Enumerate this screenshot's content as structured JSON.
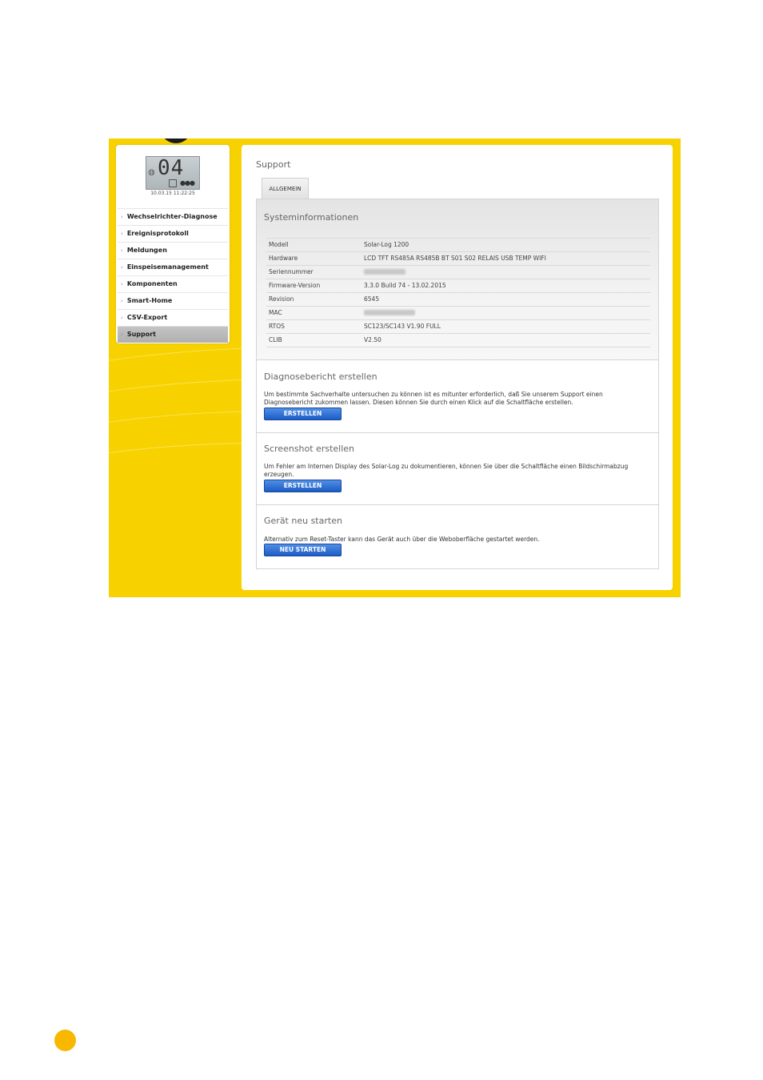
{
  "sidebar": {
    "lcd_digits": "04",
    "lcd_time": "10.03.15 11:22:25",
    "items": [
      {
        "label": "Wechselrichter-Diagnose",
        "active": false
      },
      {
        "label": "Ereignisprotokoll",
        "active": false
      },
      {
        "label": "Meldungen",
        "active": false
      },
      {
        "label": "Einspeisemanagement",
        "active": false
      },
      {
        "label": "Komponenten",
        "active": false
      },
      {
        "label": "Smart-Home",
        "active": false
      },
      {
        "label": "CSV-Export",
        "active": false
      },
      {
        "label": "Support",
        "active": true
      }
    ]
  },
  "main": {
    "title": "Support",
    "tab": "ALLGEMEIN",
    "sysinfo": {
      "title": "Systeminformationen",
      "rows": [
        {
          "key": "Modell",
          "value": "Solar-Log 1200"
        },
        {
          "key": "Hardware",
          "value": "LCD TFT RS485A RS485B BT S01 S02 RELAIS USB TEMP WIFI"
        },
        {
          "key": "Seriennummer",
          "value": "",
          "blurred": true
        },
        {
          "key": "Firmware-Version",
          "value": "3.3.0 Build 74 - 13.02.2015"
        },
        {
          "key": "Revision",
          "value": "6545"
        },
        {
          "key": "MAC",
          "value": "",
          "blurred": true
        },
        {
          "key": "RTOS",
          "value": "SC123/SC143 V1.90 FULL"
        },
        {
          "key": "CLIB",
          "value": "V2.50"
        }
      ]
    },
    "diagnose": {
      "title": "Diagnosebericht erstellen",
      "text": "Um bestimmte Sachverhalte untersuchen zu können ist es mitunter erforderlich, daß Sie unserem Support einen Diagnosebericht zukommen lassen. Diesen können Sie durch einen Klick auf die Schaltfläche erstellen.",
      "button": "ERSTELLEN"
    },
    "screenshot": {
      "title": "Screenshot erstellen",
      "text": "Um Fehler am Internen Display des Solar-Log zu dokumentieren, können Sie über die Schaltfläche einen Bildschirmabzug erzeugen.",
      "button": "ERSTELLEN"
    },
    "restart": {
      "title": "Gerät neu starten",
      "text": "Alternativ zum Reset-Taster kann das Gerät auch über die Weboberfläche gestartet werden.",
      "button": "NEU STARTEN"
    }
  },
  "colors": {
    "frame": "#f7d200",
    "button": "#2f6fd6",
    "page_marker": "#f8b800"
  }
}
